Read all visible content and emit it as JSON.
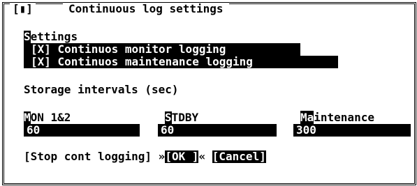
{
  "window": {
    "close_label": "[▮]",
    "title": "Continuous log settings"
  },
  "settings": {
    "heading_first": "S",
    "heading_rest": "ettings",
    "items": [
      {
        "label": "[X] Continuos monitor logging"
      },
      {
        "label": "[X] Continuos maintenance logging"
      }
    ]
  },
  "storage": {
    "heading": "Storage intervals (sec)",
    "fields": [
      {
        "label_first": "M",
        "label_rest": "ON 1&2",
        "value": "60"
      },
      {
        "label_first": "S",
        "label_rest": "TDBY",
        "value": "60"
      },
      {
        "label_first": "Ma",
        "label_rest": "intenance",
        "value": "300"
      }
    ]
  },
  "buttons": {
    "stop_label": "[Stop cont logging]",
    "ok_prefix": "»",
    "ok_label": "[OK ]",
    "ok_suffix": "«",
    "cancel_label": "[Cancel]"
  }
}
